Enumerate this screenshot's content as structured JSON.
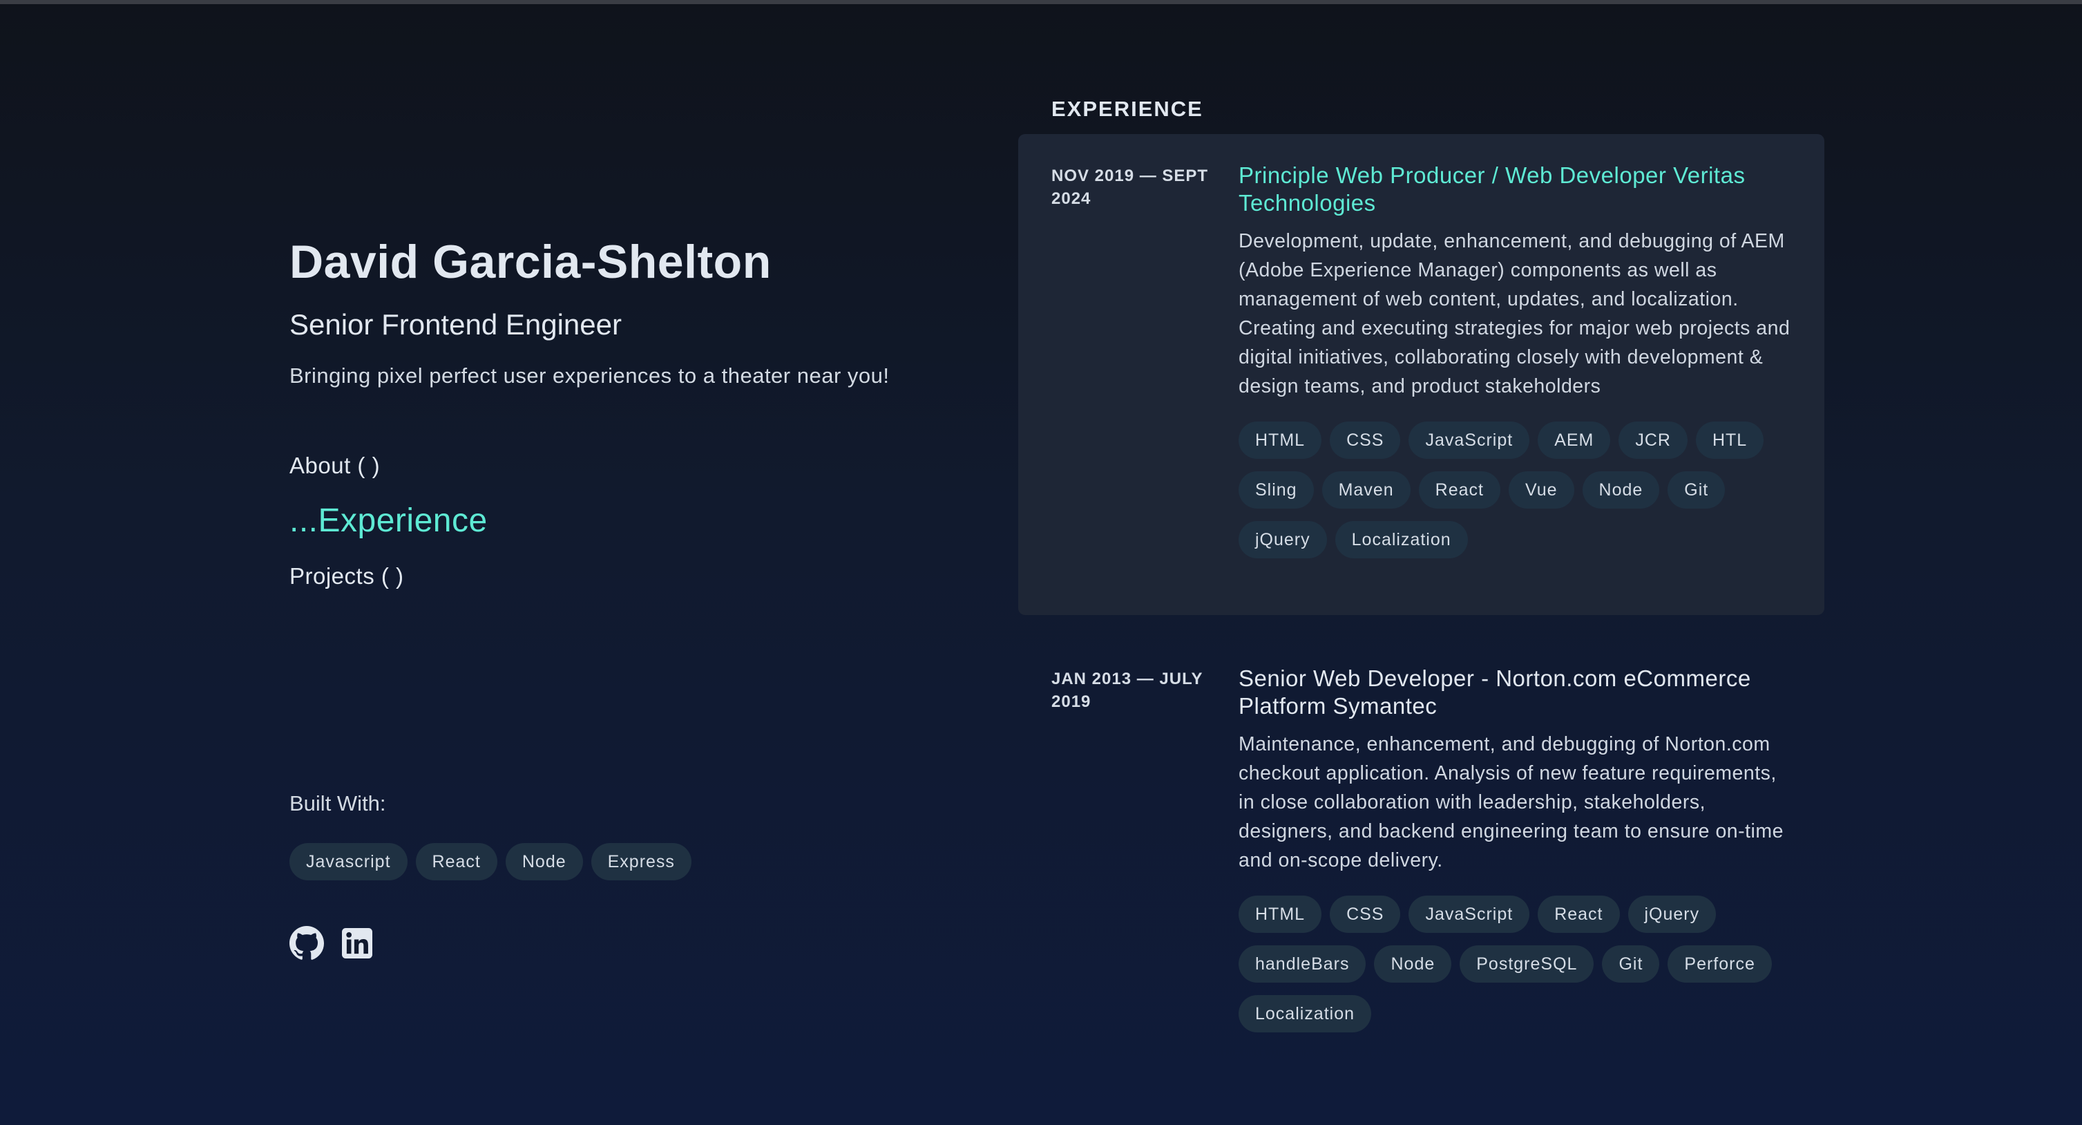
{
  "profile": {
    "name": "David Garcia-Shelton",
    "role": "Senior Frontend Engineer",
    "tagline": "Bringing pixel perfect user experiences to a theater near you!"
  },
  "nav": {
    "about": "About ( )",
    "experience": "...Experience",
    "projects": "Projects ( )"
  },
  "built": {
    "label": "Built With:",
    "items": [
      "Javascript",
      "React",
      "Node",
      "Express"
    ]
  },
  "social": [
    "github-icon",
    "linkedin-icon"
  ],
  "experience": {
    "heading": "EXPERIENCE",
    "items": [
      {
        "date": "NOV 2019 — SEPT 2024",
        "title": "Principle Web Producer / Web Developer Veritas Technologies",
        "description": "Development, update, enhancement, and debugging of AEM (Adobe Experience Manager) components as well as management of web content, updates, and localization. Creating and executing strategies for major web projects and digital initiatives, collaborating closely with development & design teams, and product stakeholders",
        "tags": [
          "HTML",
          "CSS",
          "JavaScript",
          "AEM",
          "JCR",
          "HTL",
          "Sling",
          "Maven",
          "React",
          "Vue",
          "Node",
          "Git",
          "jQuery",
          "Localization"
        ]
      },
      {
        "date": "JAN 2013 — JULY 2019",
        "title": "Senior Web Developer - Norton.com eCommerce Platform Symantec",
        "description": "Maintenance, enhancement, and debugging of Norton.com checkout application. Analysis of new feature requirements, in close collaboration with leadership, stakeholders, designers, and backend engineering team to ensure on-time and on-scope delivery.",
        "tags": [
          "HTML",
          "CSS",
          "JavaScript",
          "React",
          "jQuery",
          "handleBars",
          "Node",
          "PostgreSQL",
          "Git",
          "Perforce",
          "Localization"
        ]
      }
    ]
  },
  "colors": {
    "accent": "#5eead4",
    "card": "#1e2636",
    "pill": "#1f3142"
  }
}
